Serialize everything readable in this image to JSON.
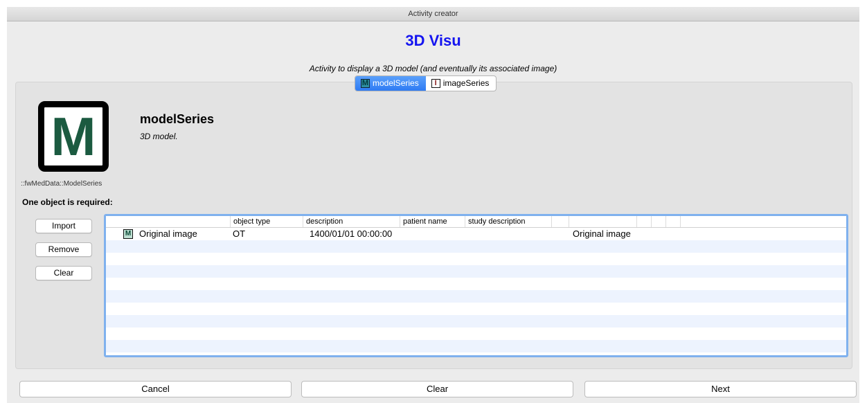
{
  "window": {
    "title": "Activity creator"
  },
  "activity": {
    "title": "3D Visu",
    "description": "Activity to display a 3D model (and eventually its associated image)"
  },
  "tabs": [
    {
      "label": "modelSeries",
      "icon_letter": "M",
      "active": true
    },
    {
      "label": "imageSeries",
      "icon_letter": "I",
      "active": false
    }
  ],
  "series_panel": {
    "icon_letter": "M",
    "type_name": "::fwMedData::ModelSeries",
    "title": "modelSeries",
    "description": "3D model.",
    "required_text": "One object is required:"
  },
  "side_buttons": {
    "import": "Import",
    "remove": "Remove",
    "clear": "Clear"
  },
  "table": {
    "columns": [
      "",
      "object type",
      "description",
      "patient name",
      "study description",
      "",
      "",
      "",
      "",
      "",
      ""
    ],
    "rows": [
      {
        "icon_letter": "M",
        "name": "Original image",
        "object_type": "OT",
        "description": "1400/01/01 00:00:00",
        "patient_name": "",
        "study_description": "",
        "extra": "Original image"
      }
    ]
  },
  "footer": {
    "cancel": "Cancel",
    "clear": "Clear",
    "next": "Next"
  },
  "colors": {
    "accent": "#2f7bf3",
    "title": "#1414f0",
    "table_border": "#7fb1ee",
    "row_alt": "#edf3fe"
  }
}
